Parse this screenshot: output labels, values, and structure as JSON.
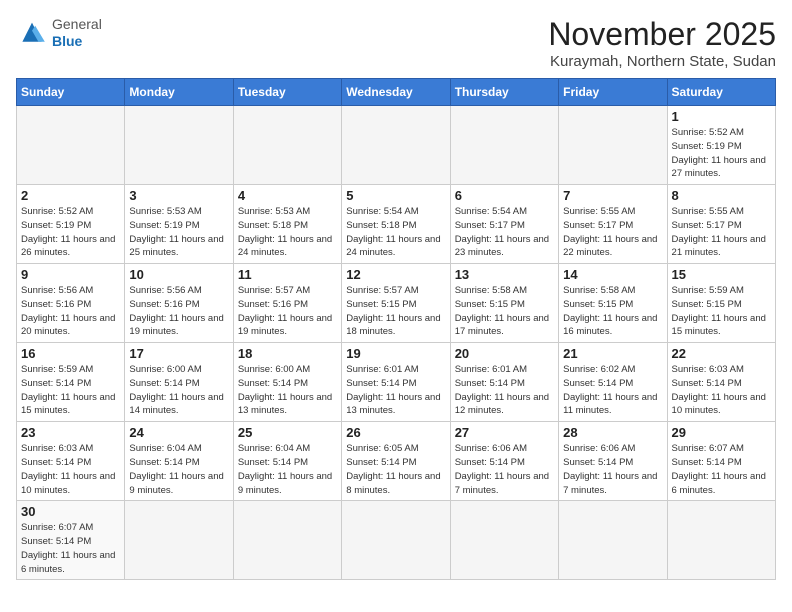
{
  "header": {
    "logo_general": "General",
    "logo_blue": "Blue",
    "month_title": "November 2025",
    "subtitle": "Kuraymah, Northern State, Sudan"
  },
  "days_of_week": [
    "Sunday",
    "Monday",
    "Tuesday",
    "Wednesday",
    "Thursday",
    "Friday",
    "Saturday"
  ],
  "weeks": [
    [
      {
        "day": "",
        "info": ""
      },
      {
        "day": "",
        "info": ""
      },
      {
        "day": "",
        "info": ""
      },
      {
        "day": "",
        "info": ""
      },
      {
        "day": "",
        "info": ""
      },
      {
        "day": "",
        "info": ""
      },
      {
        "day": "1",
        "info": "Sunrise: 5:52 AM\nSunset: 5:19 PM\nDaylight: 11 hours\nand 27 minutes."
      }
    ],
    [
      {
        "day": "2",
        "info": "Sunrise: 5:52 AM\nSunset: 5:19 PM\nDaylight: 11 hours\nand 26 minutes."
      },
      {
        "day": "3",
        "info": "Sunrise: 5:53 AM\nSunset: 5:19 PM\nDaylight: 11 hours\nand 25 minutes."
      },
      {
        "day": "4",
        "info": "Sunrise: 5:53 AM\nSunset: 5:18 PM\nDaylight: 11 hours\nand 24 minutes."
      },
      {
        "day": "5",
        "info": "Sunrise: 5:54 AM\nSunset: 5:18 PM\nDaylight: 11 hours\nand 24 minutes."
      },
      {
        "day": "6",
        "info": "Sunrise: 5:54 AM\nSunset: 5:17 PM\nDaylight: 11 hours\nand 23 minutes."
      },
      {
        "day": "7",
        "info": "Sunrise: 5:55 AM\nSunset: 5:17 PM\nDaylight: 11 hours\nand 22 minutes."
      },
      {
        "day": "8",
        "info": "Sunrise: 5:55 AM\nSunset: 5:17 PM\nDaylight: 11 hours\nand 21 minutes."
      }
    ],
    [
      {
        "day": "9",
        "info": "Sunrise: 5:56 AM\nSunset: 5:16 PM\nDaylight: 11 hours\nand 20 minutes."
      },
      {
        "day": "10",
        "info": "Sunrise: 5:56 AM\nSunset: 5:16 PM\nDaylight: 11 hours\nand 19 minutes."
      },
      {
        "day": "11",
        "info": "Sunrise: 5:57 AM\nSunset: 5:16 PM\nDaylight: 11 hours\nand 19 minutes."
      },
      {
        "day": "12",
        "info": "Sunrise: 5:57 AM\nSunset: 5:15 PM\nDaylight: 11 hours\nand 18 minutes."
      },
      {
        "day": "13",
        "info": "Sunrise: 5:58 AM\nSunset: 5:15 PM\nDaylight: 11 hours\nand 17 minutes."
      },
      {
        "day": "14",
        "info": "Sunrise: 5:58 AM\nSunset: 5:15 PM\nDaylight: 11 hours\nand 16 minutes."
      },
      {
        "day": "15",
        "info": "Sunrise: 5:59 AM\nSunset: 5:15 PM\nDaylight: 11 hours\nand 15 minutes."
      }
    ],
    [
      {
        "day": "16",
        "info": "Sunrise: 5:59 AM\nSunset: 5:14 PM\nDaylight: 11 hours\nand 15 minutes."
      },
      {
        "day": "17",
        "info": "Sunrise: 6:00 AM\nSunset: 5:14 PM\nDaylight: 11 hours\nand 14 minutes."
      },
      {
        "day": "18",
        "info": "Sunrise: 6:00 AM\nSunset: 5:14 PM\nDaylight: 11 hours\nand 13 minutes."
      },
      {
        "day": "19",
        "info": "Sunrise: 6:01 AM\nSunset: 5:14 PM\nDaylight: 11 hours\nand 13 minutes."
      },
      {
        "day": "20",
        "info": "Sunrise: 6:01 AM\nSunset: 5:14 PM\nDaylight: 11 hours\nand 12 minutes."
      },
      {
        "day": "21",
        "info": "Sunrise: 6:02 AM\nSunset: 5:14 PM\nDaylight: 11 hours\nand 11 minutes."
      },
      {
        "day": "22",
        "info": "Sunrise: 6:03 AM\nSunset: 5:14 PM\nDaylight: 11 hours\nand 10 minutes."
      }
    ],
    [
      {
        "day": "23",
        "info": "Sunrise: 6:03 AM\nSunset: 5:14 PM\nDaylight: 11 hours\nand 10 minutes."
      },
      {
        "day": "24",
        "info": "Sunrise: 6:04 AM\nSunset: 5:14 PM\nDaylight: 11 hours\nand 9 minutes."
      },
      {
        "day": "25",
        "info": "Sunrise: 6:04 AM\nSunset: 5:14 PM\nDaylight: 11 hours\nand 9 minutes."
      },
      {
        "day": "26",
        "info": "Sunrise: 6:05 AM\nSunset: 5:14 PM\nDaylight: 11 hours\nand 8 minutes."
      },
      {
        "day": "27",
        "info": "Sunrise: 6:06 AM\nSunset: 5:14 PM\nDaylight: 11 hours\nand 7 minutes."
      },
      {
        "day": "28",
        "info": "Sunrise: 6:06 AM\nSunset: 5:14 PM\nDaylight: 11 hours\nand 7 minutes."
      },
      {
        "day": "29",
        "info": "Sunrise: 6:07 AM\nSunset: 5:14 PM\nDaylight: 11 hours\nand 6 minutes."
      }
    ],
    [
      {
        "day": "30",
        "info": "Sunrise: 6:07 AM\nSunset: 5:14 PM\nDaylight: 11 hours\nand 6 minutes."
      },
      {
        "day": "",
        "info": ""
      },
      {
        "day": "",
        "info": ""
      },
      {
        "day": "",
        "info": ""
      },
      {
        "day": "",
        "info": ""
      },
      {
        "day": "",
        "info": ""
      },
      {
        "day": "",
        "info": ""
      }
    ]
  ]
}
